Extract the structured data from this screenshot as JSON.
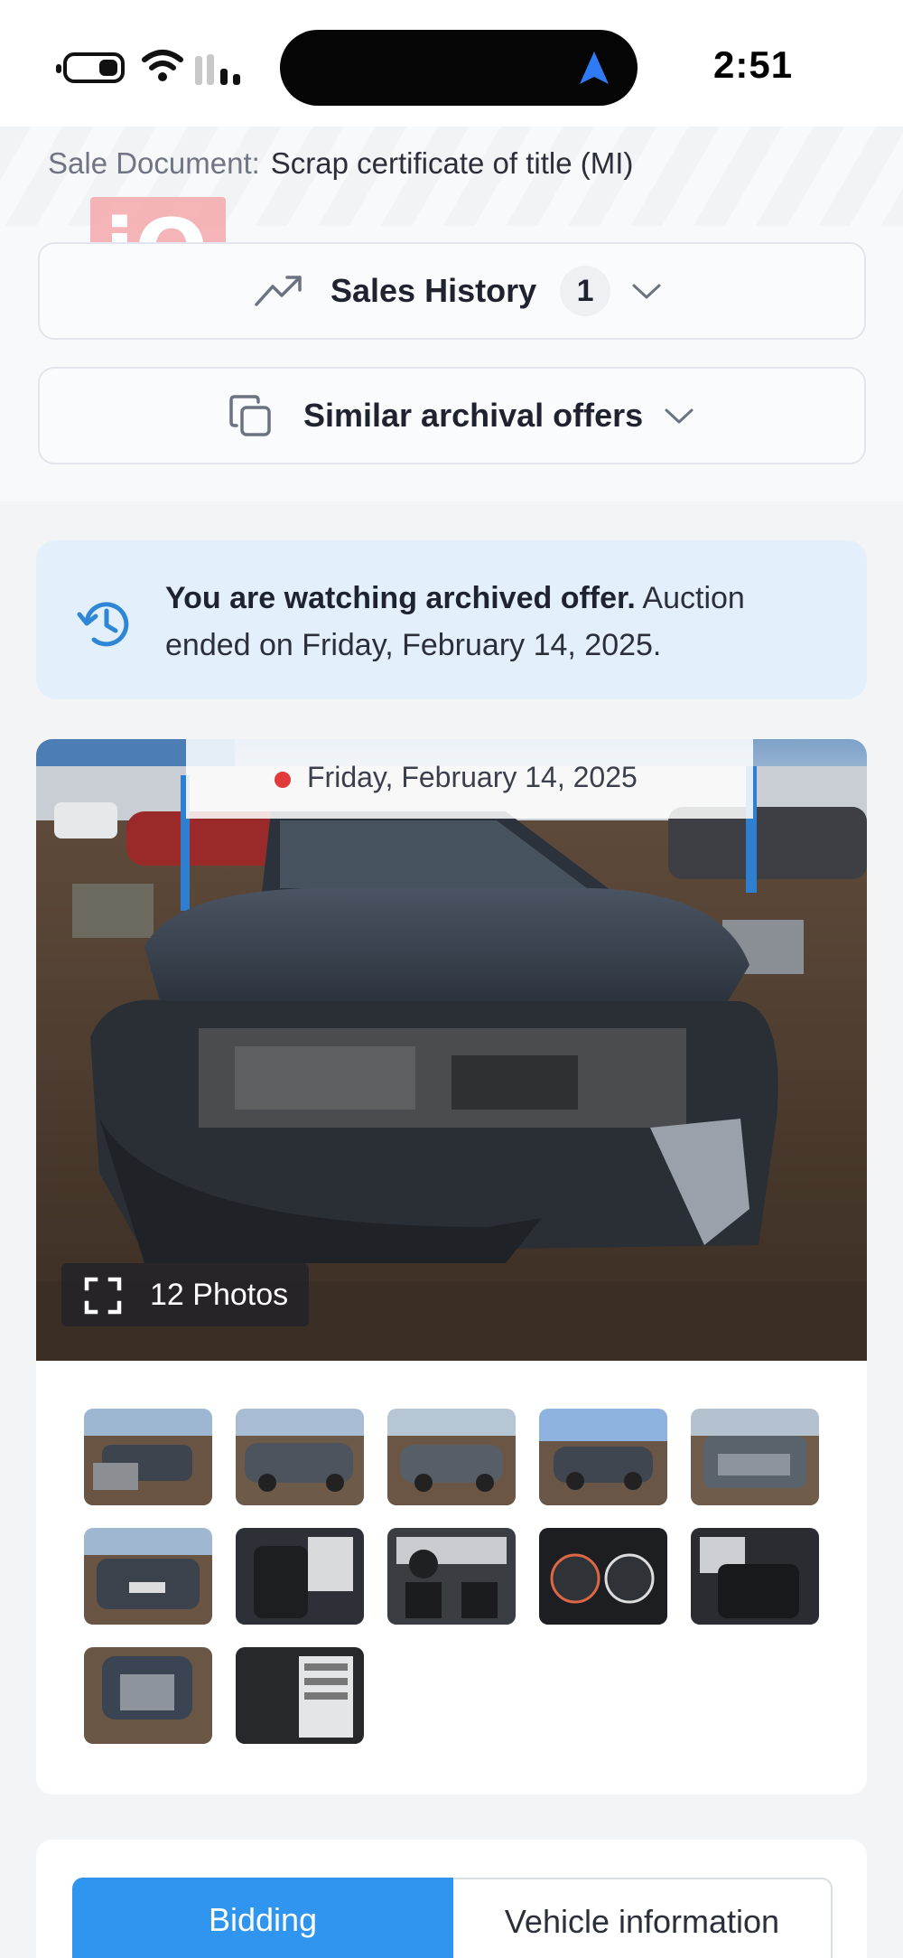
{
  "status_bar": {
    "time": "2:51"
  },
  "header": {
    "sale_document_label": "Sale Document:",
    "sale_document_value": "Scrap certificate of title (MI)",
    "logo_text": "iQ",
    "sales_history": {
      "label": "Sales History",
      "count": "1"
    },
    "similar_offers": {
      "label": "Similar archival offers"
    }
  },
  "notice": {
    "bold": "You are watching archived offer.",
    "text": " Auction ended on Friday, February 14, 2025."
  },
  "gallery": {
    "date": "Friday, February 14, 2025",
    "photo_count_label": "12 Photos",
    "thumbnails": [
      "front-damage-view",
      "rear-quarter-view",
      "side-view",
      "side-view-2",
      "front-view",
      "rear-view",
      "front-seats",
      "dashboard",
      "instrument-cluster",
      "rear-seats",
      "engine-bay",
      "door-label"
    ]
  },
  "tabs": {
    "bidding": "Bidding",
    "vehicle_information": "Vehicle information"
  },
  "colors": {
    "accent": "#2f95ee",
    "notice_bg": "#e3f0fb",
    "date_dot": "#e03a3a"
  }
}
